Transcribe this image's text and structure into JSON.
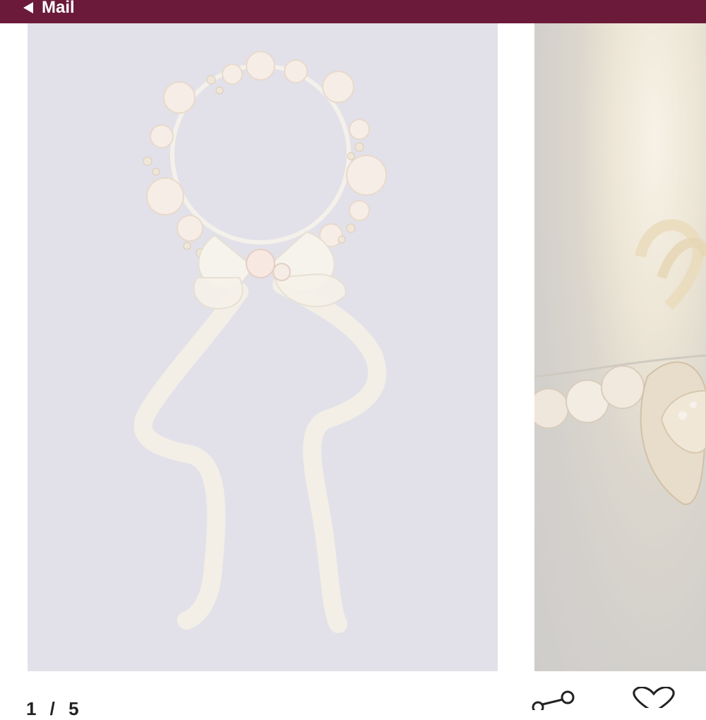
{
  "topbar": {
    "back_label": "Mail",
    "color": "#6b1a39"
  },
  "gallery": {
    "current_page": "1 / 5",
    "main_image": {
      "subject": "floral-crown-with-ribbon",
      "background": "#e2e1e9"
    },
    "detail_image": {
      "subject": "pearl-and-flower-closeup"
    }
  },
  "icons": {
    "back": "back-triangle-icon",
    "share": "share-icon",
    "favorite": "heart-icon"
  }
}
